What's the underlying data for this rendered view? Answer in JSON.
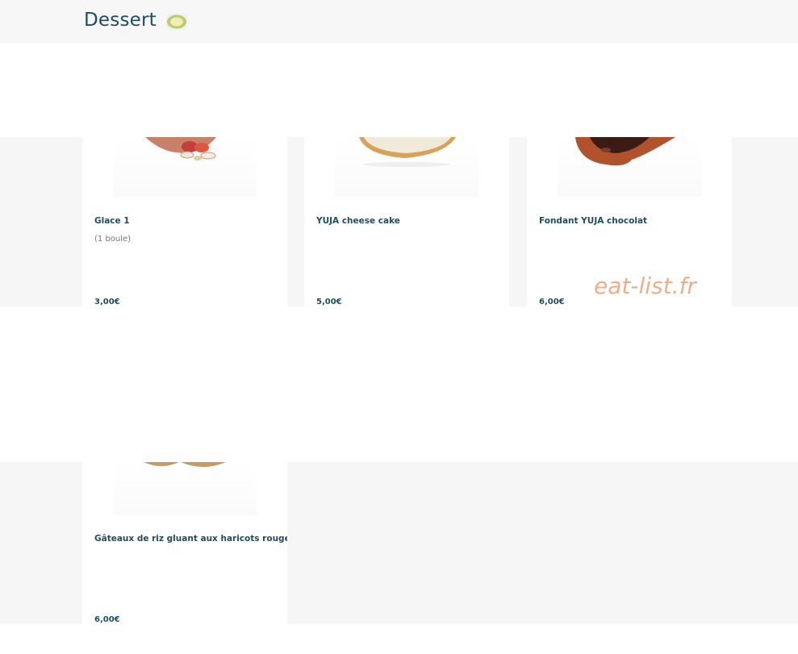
{
  "header": {
    "title": "Dessert",
    "icon": "dish-icon",
    "icon_color": "#b6cf6b"
  },
  "items": [
    {
      "name": "Glace 1",
      "description": "(1 boule)",
      "price": "3,00€"
    },
    {
      "name": "YUJA cheese cake",
      "description": "",
      "price": "5,00€"
    },
    {
      "name": "Fondant YUJA chocolat",
      "description": "",
      "price": "6,00€"
    },
    {
      "name": "Gâteaux de riz gluant aux haricots rouges",
      "description": "",
      "price": "6,00€"
    }
  ],
  "watermark": "eat-list.fr",
  "colors": {
    "accent": "#1d4e5e",
    "watermark": "#f0a67a",
    "band": "#f6f6f6"
  }
}
